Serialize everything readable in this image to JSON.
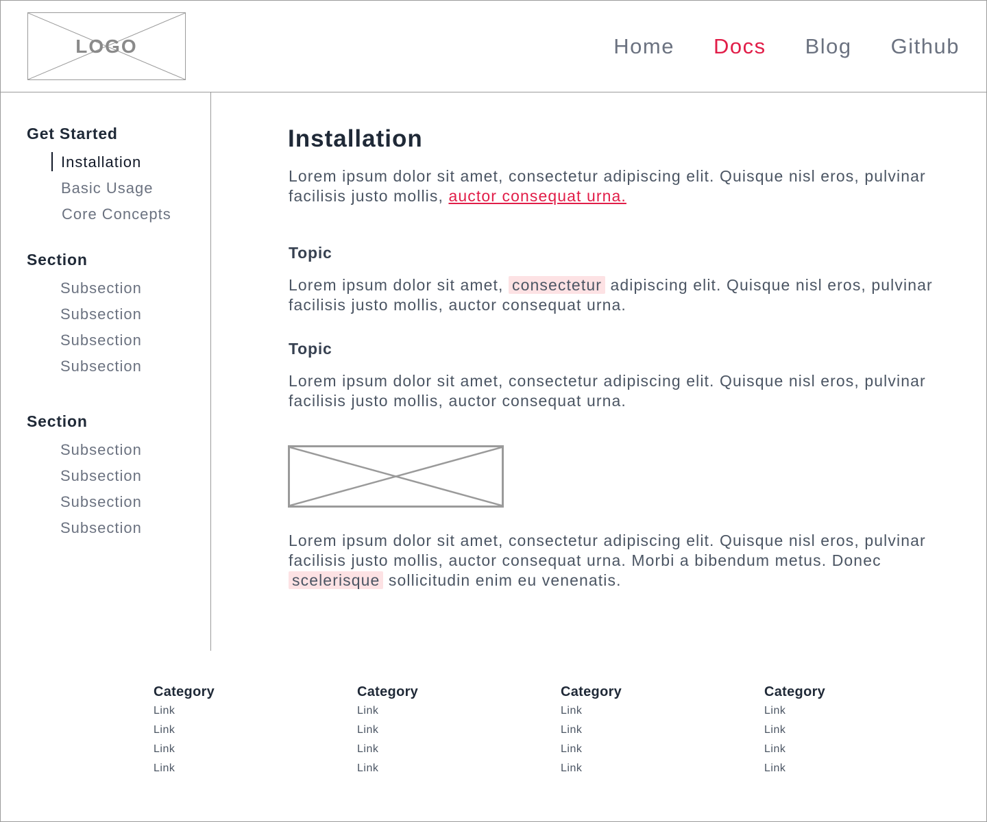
{
  "header": {
    "logo_text": "LOGO",
    "nav": [
      {
        "label": "Home",
        "active": false
      },
      {
        "label": "Docs",
        "active": true
      },
      {
        "label": "Blog",
        "active": false
      },
      {
        "label": "Github",
        "active": false
      }
    ]
  },
  "sidebar": {
    "sections": [
      {
        "heading": "Get Started",
        "items": [
          "Installation",
          "Basic Usage",
          "Core Concepts"
        ]
      },
      {
        "heading": "Section",
        "items": [
          "Subsection",
          "Subsection",
          "Subsection",
          "Subsection"
        ]
      },
      {
        "heading": "Section",
        "items": [
          "Subsection",
          "Subsection",
          "Subsection",
          "Subsection"
        ]
      }
    ],
    "active_item": "Installation"
  },
  "main": {
    "title": "Installation",
    "intro": {
      "text": "Lorem ipsum dolor sit amet, consectetur adipiscing elit. Quisque nisl eros, pulvinar facilisis justo mollis, ",
      "link": "auctor consequat urna."
    },
    "topic1": {
      "heading": "Topic",
      "before": "Lorem ipsum dolor sit amet, ",
      "highlight": "consectetur",
      "after": " adipiscing elit. Quisque nisl eros, pulvinar facilisis justo mollis, auctor consequat urna."
    },
    "topic2": {
      "heading": "Topic",
      "text": "Lorem ipsum dolor sit amet, consectetur adipiscing elit. Quisque nisl eros, pulvinar facilisis justo mollis, auctor consequat urna."
    },
    "closing": {
      "before": "Lorem ipsum dolor sit amet, consectetur adipiscing elit. Quisque nisl eros, pulvinar facilisis justo mollis, auctor consequat urna. Morbi a bibendum metus. Donec ",
      "highlight": "scelerisque",
      "after": " sollicitudin enim eu venenatis."
    }
  },
  "footer": {
    "columns": [
      {
        "heading": "Category",
        "links": [
          "Link",
          "Link",
          "Link",
          "Link"
        ]
      },
      {
        "heading": "Category",
        "links": [
          "Link",
          "Link",
          "Link",
          "Link"
        ]
      },
      {
        "heading": "Category",
        "links": [
          "Link",
          "Link",
          "Link",
          "Link"
        ]
      },
      {
        "heading": "Category",
        "links": [
          "Link",
          "Link",
          "Link",
          "Link"
        ]
      }
    ]
  },
  "colors": {
    "accent": "#e11d48",
    "highlight_bg": "#fde2e4",
    "border": "#9a9a9a",
    "text_muted": "#6b7280"
  }
}
